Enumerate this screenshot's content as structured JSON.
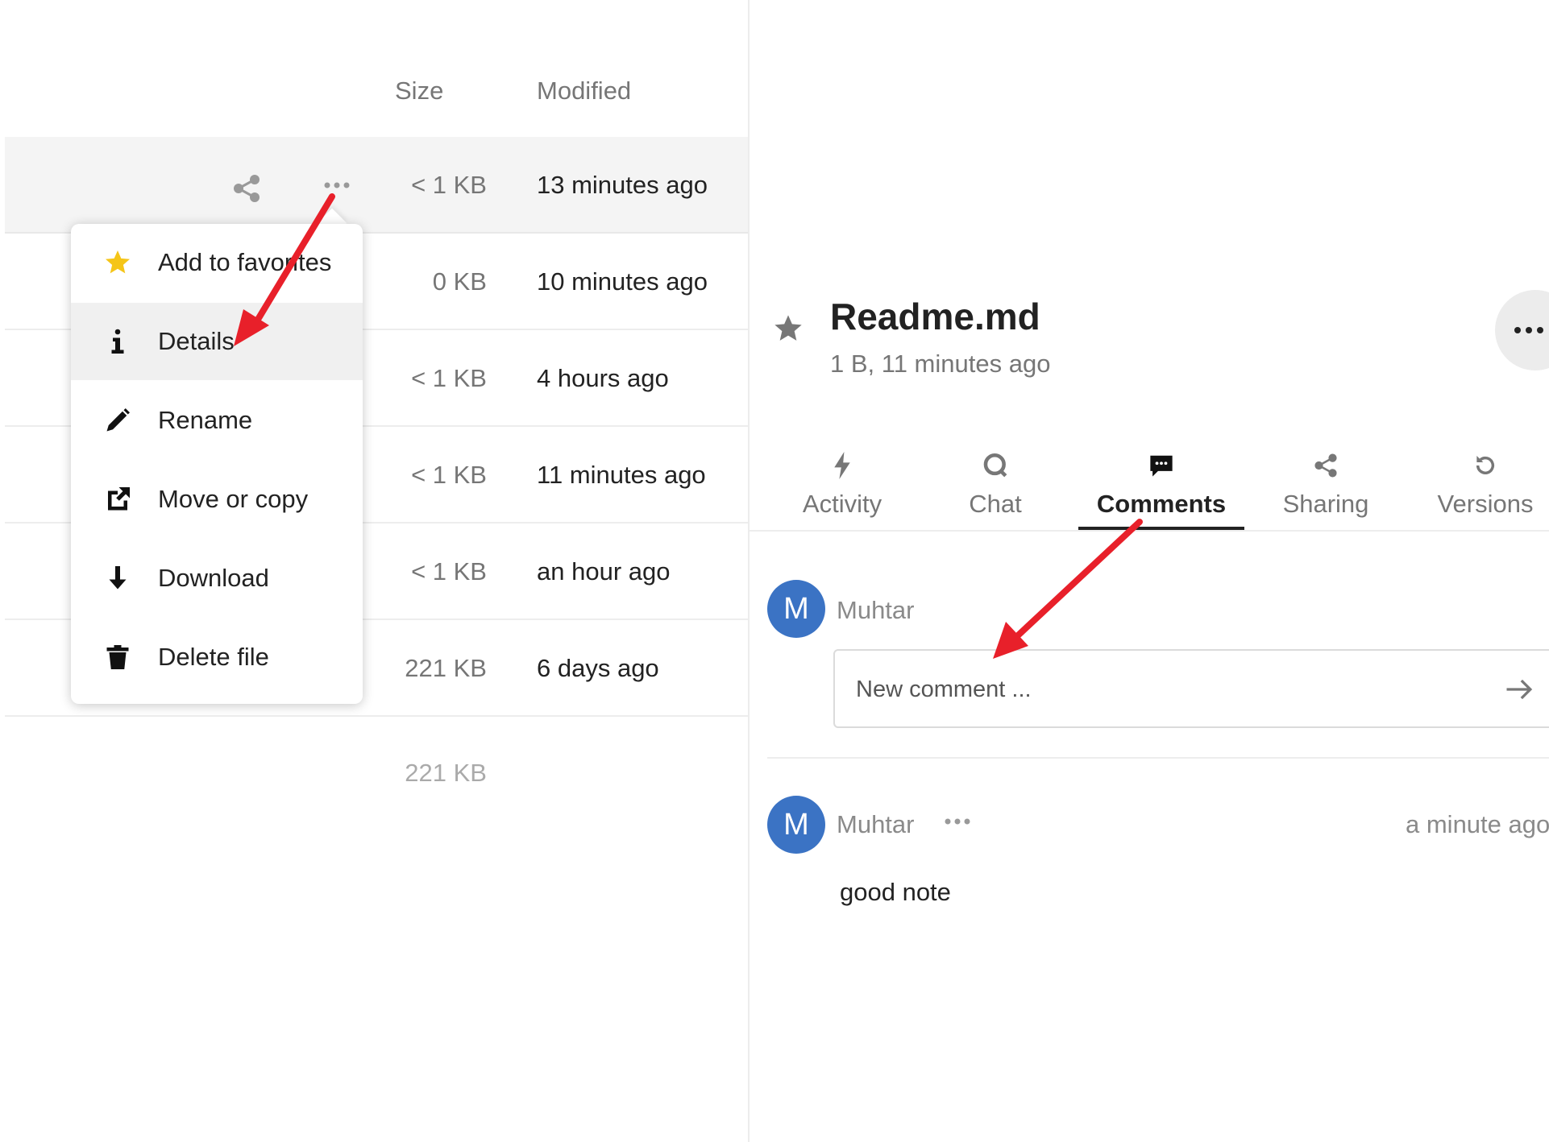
{
  "file_list": {
    "columns": {
      "size": "Size",
      "modified": "Modified"
    },
    "rows": [
      {
        "size": "< 1 KB",
        "modified": "13 minutes ago"
      },
      {
        "size": "0 KB",
        "modified": "10 minutes ago"
      },
      {
        "size": "< 1 KB",
        "modified": "4 hours ago"
      },
      {
        "size": "< 1 KB",
        "modified": "11 minutes ago"
      },
      {
        "size": "< 1 KB",
        "modified": "an hour ago"
      },
      {
        "size": "221 KB",
        "modified": "6 days ago"
      }
    ],
    "total_size": "221 KB"
  },
  "context_menu": {
    "items": [
      {
        "label": "Add to favorites",
        "icon": "star-icon"
      },
      {
        "label": "Details",
        "icon": "info-icon"
      },
      {
        "label": "Rename",
        "icon": "pencil-icon"
      },
      {
        "label": "Move or copy",
        "icon": "external-link-icon"
      },
      {
        "label": "Download",
        "icon": "download-icon"
      },
      {
        "label": "Delete file",
        "icon": "trash-icon"
      }
    ],
    "active_item": "Details"
  },
  "details": {
    "title": "Readme.md",
    "subtitle": "1 B, 11 minutes ago",
    "tabs": [
      {
        "label": "Activity",
        "icon": "lightning-icon"
      },
      {
        "label": "Chat",
        "icon": "chat-bubble-icon"
      },
      {
        "label": "Comments",
        "icon": "comment-icon"
      },
      {
        "label": "Sharing",
        "icon": "share-icon"
      },
      {
        "label": "Versions",
        "icon": "history-icon"
      }
    ],
    "active_tab": "Comments"
  },
  "comments": {
    "current_user": {
      "initial": "M",
      "name": "Muhtar"
    },
    "input_placeholder": "New comment ...",
    "items": [
      {
        "initial": "M",
        "author": "Muhtar",
        "time": "a minute ago",
        "text": "good note"
      }
    ]
  },
  "colors": {
    "accent": "#3b73c4",
    "star": "#f5c518",
    "annotation_arrow": "#e8202a"
  }
}
